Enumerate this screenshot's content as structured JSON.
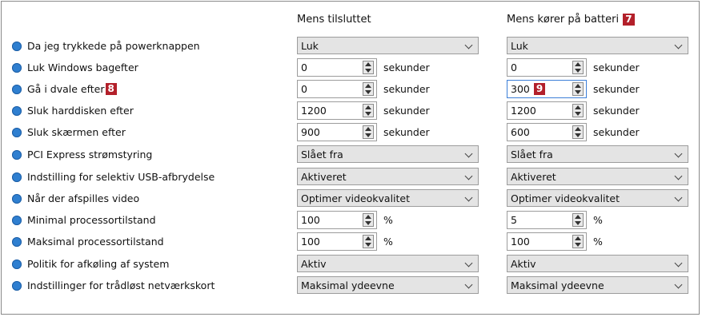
{
  "columns": {
    "plugged_in": "Mens tilsluttet",
    "battery": "Mens kører på batteri",
    "battery_badge": "7"
  },
  "units": {
    "seconds": "sekunder",
    "percent": "%"
  },
  "rows": [
    {
      "label": "Da jeg trykkede på powerknappen",
      "ac": "Luk",
      "dc": "Luk"
    },
    {
      "label": "Luk Windows bagefter",
      "ac": "0",
      "dc": "0"
    },
    {
      "label": "Gå i dvale efter",
      "badge": "8",
      "ac": "0",
      "dc": "300",
      "dc_badge": "9"
    },
    {
      "label": "Sluk harddisken efter",
      "ac": "1200",
      "dc": "1200"
    },
    {
      "label": "Sluk skærmen efter",
      "ac": "900",
      "dc": "600"
    },
    {
      "label": "PCI Express strømstyring",
      "ac": "Slået fra",
      "dc": "Slået fra"
    },
    {
      "label": "Indstilling for selektiv USB-afbrydelse",
      "ac": "Aktiveret",
      "dc": "Aktiveret"
    },
    {
      "label": "Når der afspilles video",
      "ac": "Optimer videokvalitet",
      "dc": "Optimer videokvalitet"
    },
    {
      "label": "Minimal processortilstand",
      "ac": "100",
      "dc": "5"
    },
    {
      "label": "Maksimal processortilstand",
      "ac": "100",
      "dc": "100"
    },
    {
      "label": "Politik for afkøling af system",
      "ac": "Aktiv",
      "dc": "Aktiv"
    },
    {
      "label": "Indstillinger for trådløst netværkskort",
      "ac": "Maksimal ydeevne",
      "dc": "Maksimal ydeevne"
    }
  ],
  "colors": {
    "badge": "#b3202a",
    "info_icon": "#2f7fd0",
    "dropdown_bg": "#e4e4e4"
  }
}
